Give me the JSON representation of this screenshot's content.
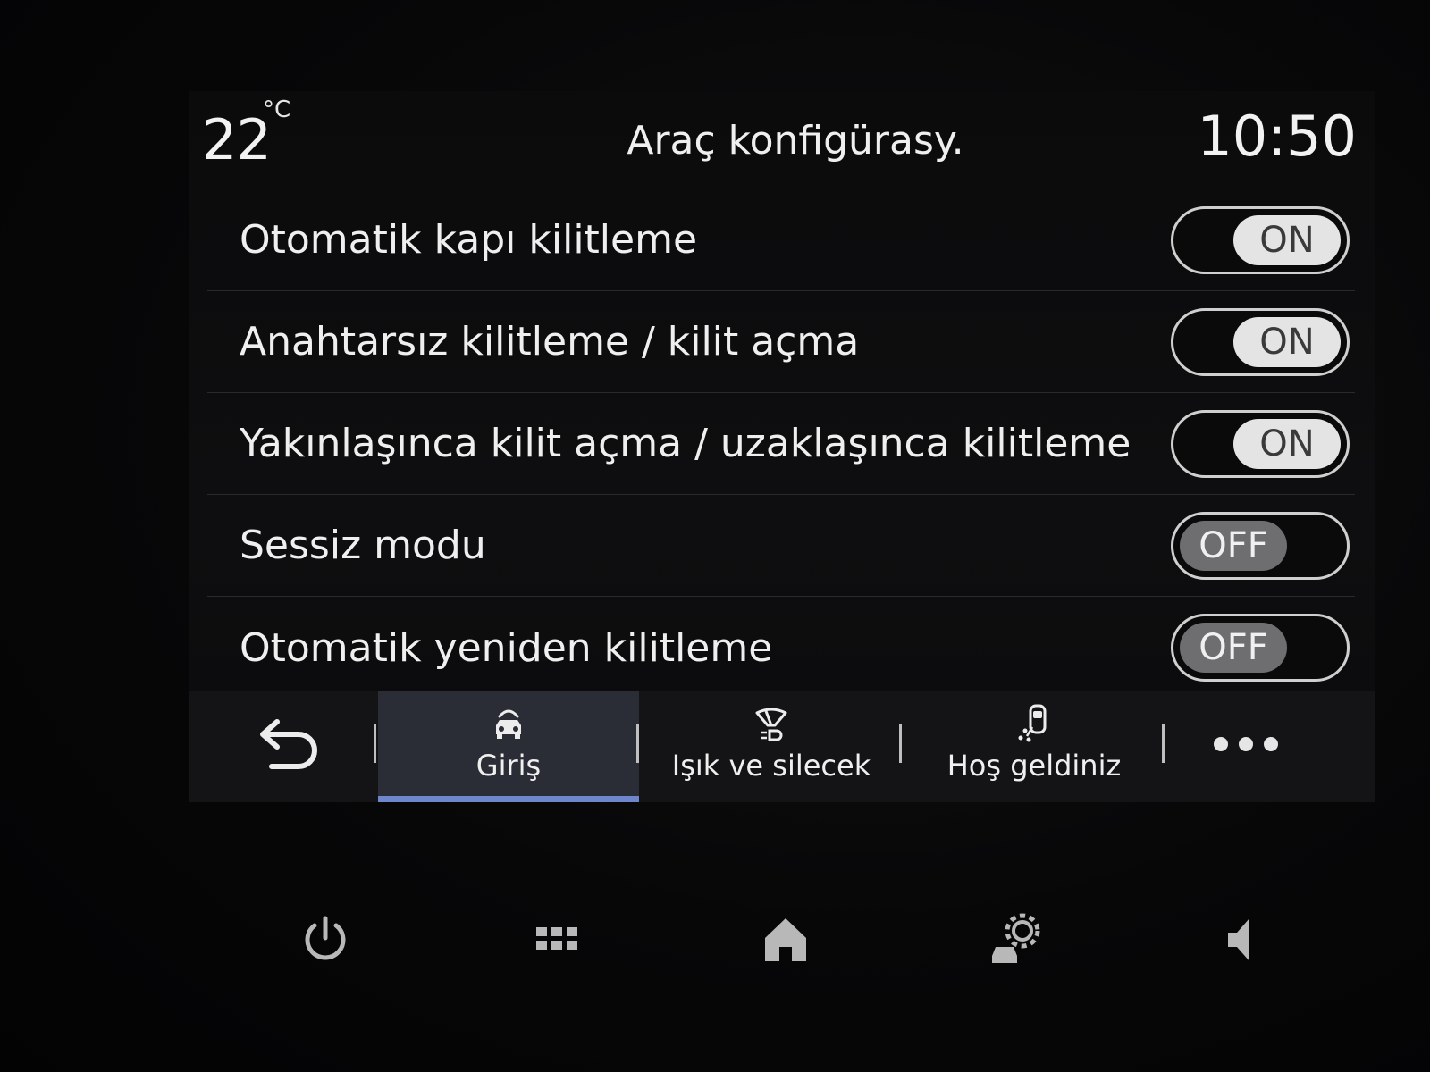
{
  "status_bar": {
    "temperature": "22",
    "temperature_unit": "°C",
    "title": "Araç konfigürasy.",
    "time": "10:50"
  },
  "settings": [
    {
      "label": "Otomatik kapı kilitleme",
      "state": "ON"
    },
    {
      "label": "Anahtarsız kilitleme / kilit açma",
      "state": "ON"
    },
    {
      "label": "Yakınlaşınca kilit açma / uzaklaşınca kilitleme",
      "state": "ON"
    },
    {
      "label": "Sessiz modu",
      "state": "OFF"
    },
    {
      "label": "Otomatik yeniden kilitleme",
      "state": "OFF"
    }
  ],
  "tabs": [
    {
      "label": "Giriş",
      "icon": "car-door-icon",
      "active": true
    },
    {
      "label": "Işık ve silecek",
      "icon": "wiper-icon",
      "active": false
    },
    {
      "label": "Hoş geldiniz",
      "icon": "welcome-icon",
      "active": false
    }
  ],
  "tabbar": {
    "back_icon": "back-arrow-icon",
    "more_icon": "more-icon"
  },
  "hardware_buttons": [
    "power-icon",
    "apps-grid-icon",
    "home-icon",
    "car-settings-icon",
    "volume-icon"
  ],
  "colors": {
    "accent": "#6f86cc",
    "toggle_on_knob": "#e4e4e4",
    "toggle_off_knob": "#6e6e70"
  }
}
